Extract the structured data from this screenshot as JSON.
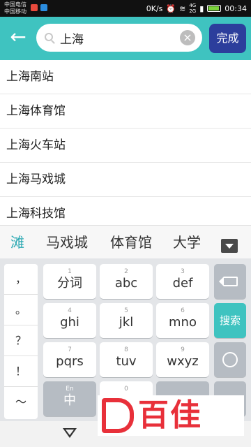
{
  "status_bar": {
    "carrier_1": "中国电信",
    "carrier_2": "中国移动",
    "speed": "0K/s",
    "net_top": "4G",
    "net_bottom": "2G",
    "time": "00:34"
  },
  "search": {
    "value": "上海",
    "done_label": "完成"
  },
  "suggestions": [
    "上海南站",
    "上海体育馆",
    "上海火车站",
    "上海马戏城",
    "上海科技馆"
  ],
  "candidates": [
    "滩",
    "马戏城",
    "体育馆",
    "大学"
  ],
  "keyboard": {
    "symbols": [
      "，",
      "。",
      "？",
      "！",
      "～"
    ],
    "keys": [
      {
        "num": "1",
        "label": "分词"
      },
      {
        "num": "2",
        "label": "abc"
      },
      {
        "num": "3",
        "label": "def"
      },
      {
        "num": "4",
        "label": "ghi"
      },
      {
        "num": "5",
        "label": "jkl"
      },
      {
        "num": "6",
        "label": "mno"
      },
      {
        "num": "7",
        "label": "pqrs"
      },
      {
        "num": "8",
        "label": "tuv"
      },
      {
        "num": "9",
        "label": "wxyz"
      }
    ],
    "lang_key_top": "En",
    "lang_key_label": "中",
    "zero_num": "0",
    "search_label": "搜索"
  },
  "watermark": {
    "brand": "百佳"
  },
  "colors": {
    "accent_teal": "#3fc3c0",
    "done_button": "#2c3e9c",
    "candidate_active": "#2aa8b2",
    "watermark_red": "#e8303a"
  }
}
